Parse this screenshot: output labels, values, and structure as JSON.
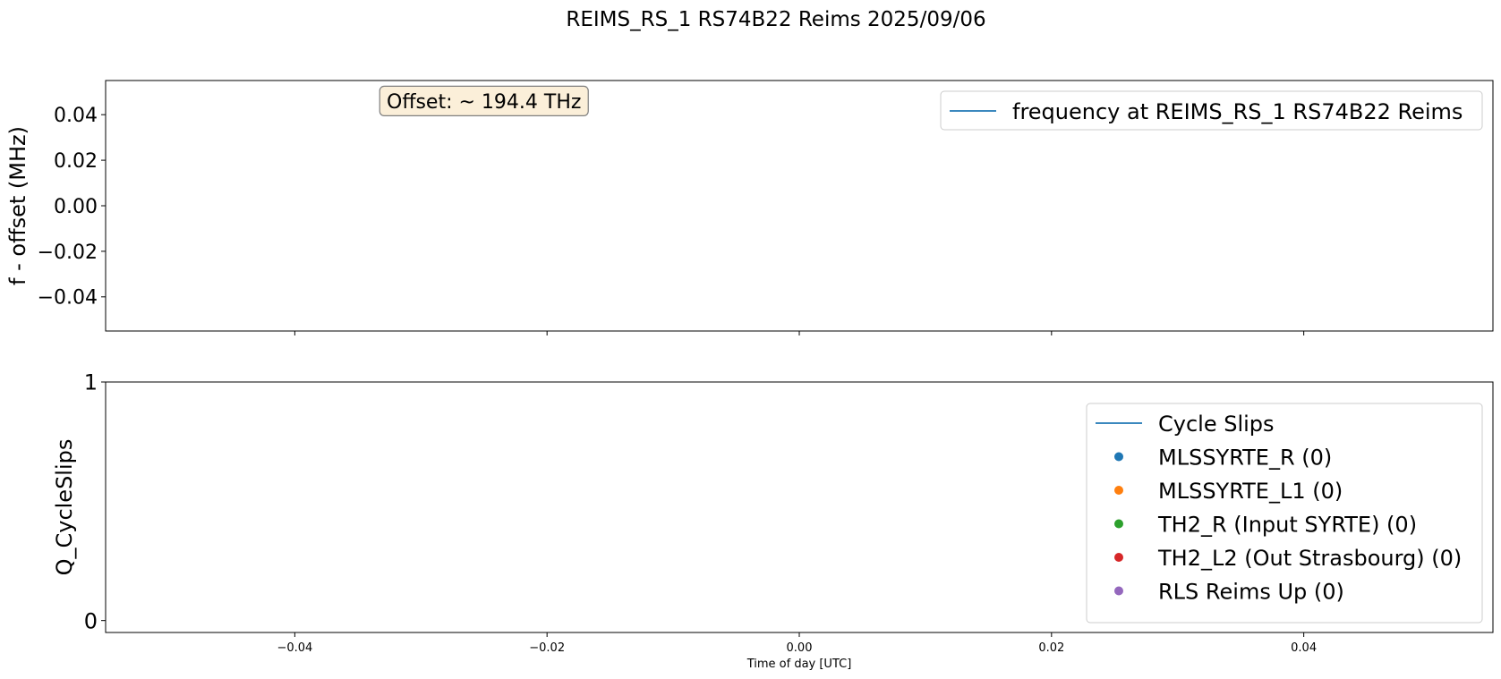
{
  "suptitle": "REIMS_RS_1 RS74B22 Reims 2025/09/06",
  "chart_data": [
    {
      "type": "line",
      "title": "",
      "xlabel": "",
      "ylabel": "f - offset (MHz)",
      "xlim": [
        -0.055,
        0.055
      ],
      "ylim": [
        -0.055,
        0.055
      ],
      "x_ticks": [
        -0.04,
        -0.02,
        0.0,
        0.02,
        0.04
      ],
      "x_tick_labels_visible": false,
      "y_ticks": [
        0.04,
        0.02,
        0.0,
        -0.02,
        -0.04
      ],
      "y_tick_labels": [
        "0.04",
        "0.02",
        "0.00",
        "−0.02",
        "−0.04"
      ],
      "annotation": "Offset: ~ 194.4 THz",
      "annotation_x": -0.025,
      "annotation_y": 0.046,
      "grid": false,
      "legend_position": "upper right",
      "series": [
        {
          "name": "frequency at REIMS_RS_1 RS74B22 Reims",
          "color": "#1f77b4",
          "marker": "line",
          "x": [],
          "y": []
        }
      ]
    },
    {
      "type": "scatter",
      "title": "",
      "xlabel": "Time of day [UTC]",
      "ylabel": "Q_CycleSlips",
      "xlim": [
        -0.055,
        0.055
      ],
      "ylim": [
        -0.05,
        1.0
      ],
      "x_ticks": [
        -0.04,
        -0.02,
        0.0,
        0.02,
        0.04
      ],
      "x_tick_labels": [
        "−0.04",
        "−0.02",
        "0.00",
        "0.02",
        "0.04"
      ],
      "y_ticks": [
        1,
        0
      ],
      "y_tick_labels": [
        "1",
        "0"
      ],
      "grid": false,
      "legend_position": "center right",
      "series": [
        {
          "name": "Cycle Slips",
          "color": "#1f77b4",
          "marker": "line",
          "x": [],
          "y": []
        },
        {
          "name": "MLSSYRTE_R (0)",
          "color": "#1f77b4",
          "marker": "dot",
          "x": [],
          "y": []
        },
        {
          "name": "MLSSYRTE_L1 (0)",
          "color": "#ff7f0e",
          "marker": "dot",
          "x": [],
          "y": []
        },
        {
          "name": "TH2_R (Input SYRTE) (0)",
          "color": "#2ca02c",
          "marker": "dot",
          "x": [],
          "y": []
        },
        {
          "name": "TH2_L2 (Out Strasbourg) (0)",
          "color": "#d62728",
          "marker": "dot",
          "x": [],
          "y": []
        },
        {
          "name": "RLS Reims Up (0)",
          "color": "#9467bd",
          "marker": "dot",
          "x": [],
          "y": []
        }
      ]
    }
  ]
}
